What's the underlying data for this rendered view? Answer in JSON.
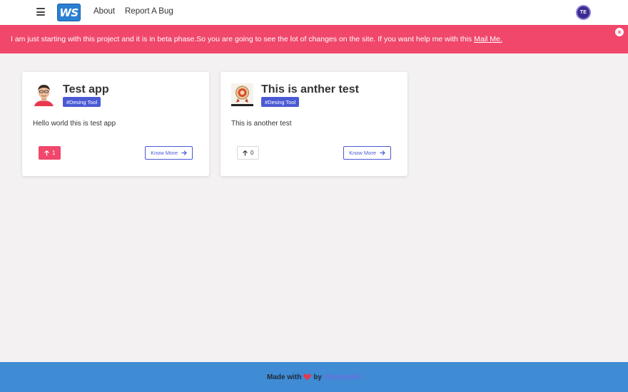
{
  "navbar": {
    "logo_text": "WS",
    "links": [
      {
        "label": "About"
      },
      {
        "label": "Report A Bug"
      }
    ],
    "avatar_initials": "TE"
  },
  "alert": {
    "message": "I am just starting with this project and it is in beta phase.So you are going to see the lot of changes on the site. If you want help me with this",
    "link_text": "Mail Me.",
    "close_symbol": "×",
    "color": "#f0476b"
  },
  "cards": [
    {
      "title": "Test app",
      "tag": "#Desing Tool",
      "description": "Hello world this is test app",
      "votes": "1",
      "vote_active": true,
      "button_label": "Know More"
    },
    {
      "title": "This is anther test",
      "tag": "#Desing Tool",
      "description": "This is another test",
      "votes": "0",
      "vote_active": false,
      "button_label": "Know More"
    }
  ],
  "footer": {
    "prefix": "Made with",
    "middle": "by",
    "handle": "@tazim404"
  },
  "colors": {
    "accent": "#4a5ad4",
    "alert": "#f0476b",
    "footer": "#3f8bd4"
  }
}
